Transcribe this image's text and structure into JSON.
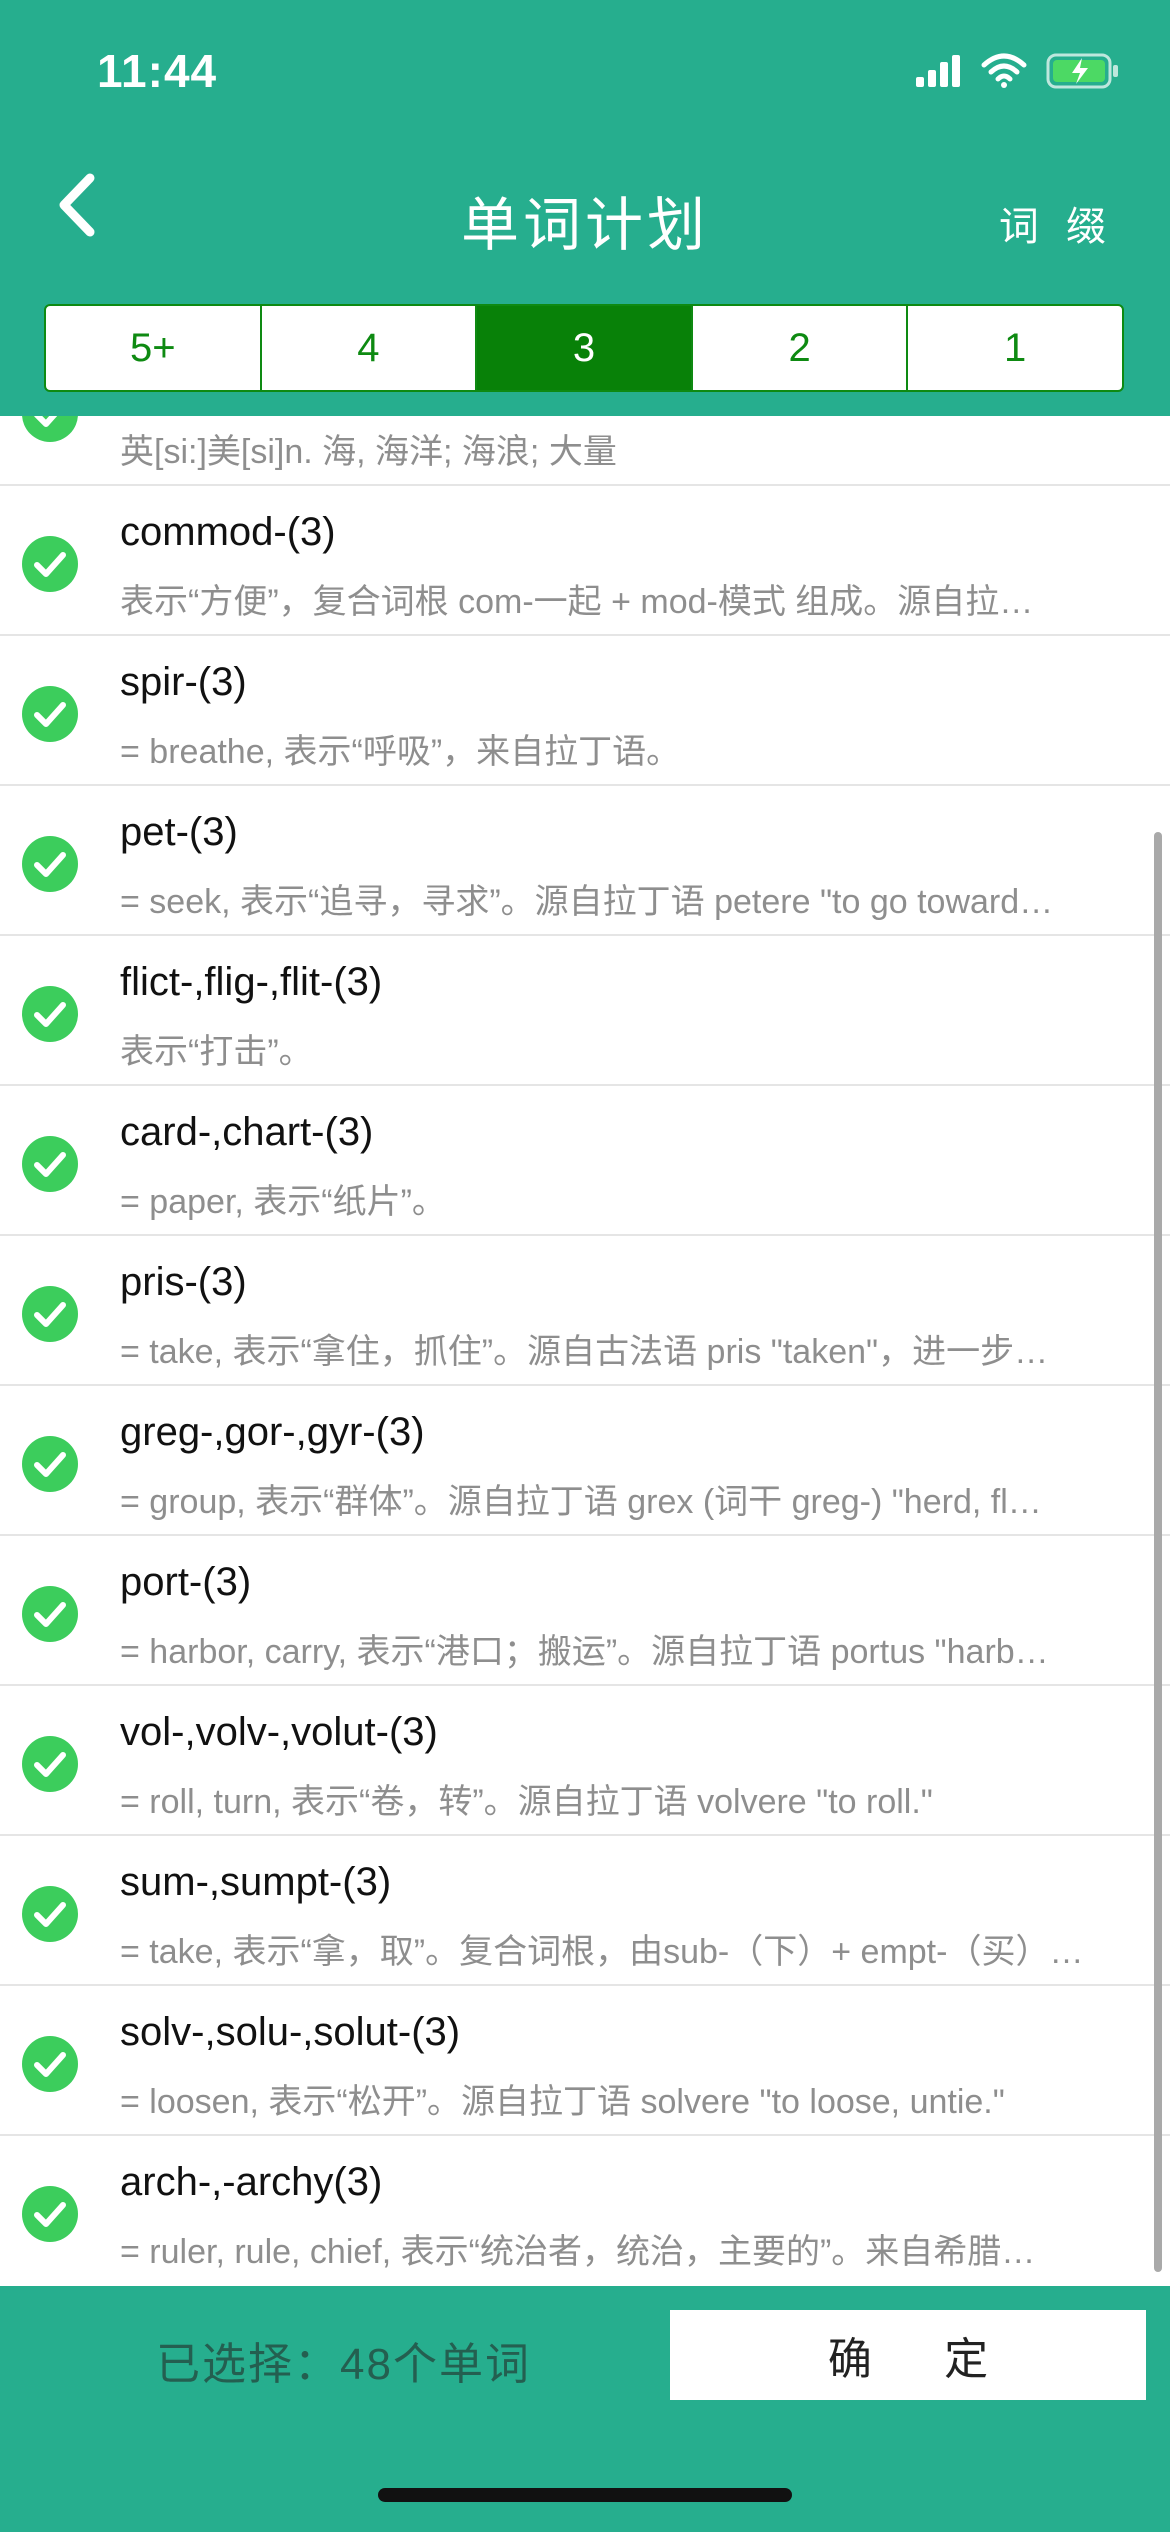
{
  "status": {
    "time": "11:44"
  },
  "nav": {
    "title": "单词计划",
    "right": "词 缀"
  },
  "segments": [
    {
      "label": "5+",
      "active": false
    },
    {
      "label": "4",
      "active": false
    },
    {
      "label": "3",
      "active": true
    },
    {
      "label": "2",
      "active": false
    },
    {
      "label": "1",
      "active": false
    }
  ],
  "items": [
    {
      "term": "",
      "desc": "英[si:]美[si]n. 海, 海洋; 海浪; 大量"
    },
    {
      "term": "commod-(3)",
      "desc": "表示“方便”，复合词根 com-一起 + mod-模式 组成。源自拉…"
    },
    {
      "term": "spir-(3)",
      "desc": "= breathe, 表示“呼吸”，来自拉丁语。"
    },
    {
      "term": "pet-(3)",
      "desc": "= seek, 表示“追寻，寻求”。源自拉丁语 petere \"to go toward…"
    },
    {
      "term": "flict-,flig-,flit-(3)",
      "desc": "表示“打击”。"
    },
    {
      "term": "card-,chart-(3)",
      "desc": "= paper, 表示“纸片”。"
    },
    {
      "term": "pris-(3)",
      "desc": "= take, 表示“拿住，抓住”。源自古法语 pris \"taken\"，进一步…"
    },
    {
      "term": "greg-,gor-,gyr-(3)",
      "desc": "= group, 表示“群体”。源自拉丁语 grex (词干 greg-) \"herd, fl…"
    },
    {
      "term": "port-(3)",
      "desc": "= harbor, carry, 表示“港口；搬运”。源自拉丁语 portus \"harb…"
    },
    {
      "term": "vol-,volv-,volut-(3)",
      "desc": "= roll, turn, 表示“卷，转”。源自拉丁语 volvere \"to roll.\""
    },
    {
      "term": "sum-,sumpt-(3)",
      "desc": "= take, 表示“拿，取”。复合词根，由sub-（下）+ empt-（买）…"
    },
    {
      "term": "solv-,solu-,solut-(3)",
      "desc": "= loosen, 表示“松开”。源自拉丁语 solvere \"to loose, untie.\""
    },
    {
      "term": "arch-,-archy(3)",
      "desc": "= ruler, rule, chief, 表示“统治者，统治，主要的”。来自希腊…"
    }
  ],
  "footer": {
    "selected": "已选择：48个单词",
    "confirm": "确 定"
  },
  "colors": {
    "header_bg": "#26ae8e",
    "segment_active": "#088108",
    "check": "#3ccd5c"
  }
}
